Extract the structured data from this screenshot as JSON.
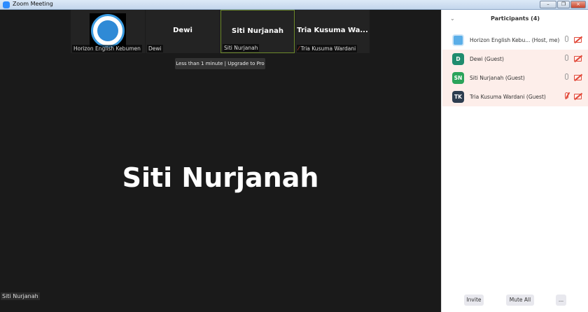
{
  "window": {
    "title": "Zoom Meeting",
    "minimize": "–",
    "restore": "❐",
    "close": "×"
  },
  "thumbnails": [
    {
      "name": "",
      "label": "Horizon English Kebumen",
      "has_logo": true
    },
    {
      "name": "Dewi",
      "label": "Dewi"
    },
    {
      "name": "Siti Nurjanah",
      "label": "Siti Nurjanah",
      "active": true
    },
    {
      "name": "Tria Kusuma Wa...",
      "label": "Tria Kusuma Wardani",
      "muted": true
    }
  ],
  "tooltip": "Less than 1 minute | Upgrade to Pro",
  "speaker": {
    "name": "Siti Nurjanah",
    "label": "Siti Nurjanah"
  },
  "participants": {
    "title": "Participants (4)",
    "items": [
      {
        "initials": "",
        "name": "Horizon English Kebu... (Host, me)",
        "color": "#5aaee8",
        "mic_muted": false,
        "video_off": true
      },
      {
        "initials": "D",
        "name": "Dewi (Guest)",
        "color": "#1f8c6e",
        "mic_muted": false,
        "video_off": true
      },
      {
        "initials": "SN",
        "name": "Siti Nurjanah (Guest)",
        "color": "#2aa35a",
        "mic_muted": false,
        "video_off": true
      },
      {
        "initials": "TK",
        "name": "Tria Kusuma Wardani (Guest)",
        "color": "#2d3d50",
        "mic_muted": true,
        "video_off": true
      }
    ],
    "invite": "Invite",
    "mute_all": "Mute All",
    "more": "..."
  }
}
